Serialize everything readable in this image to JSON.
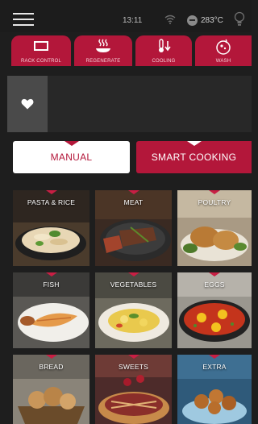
{
  "status_bar": {
    "menu_icon": "hamburger-menu-icon",
    "time": "13:11",
    "wifi_icon": "wifi-icon",
    "temperature": "283°C",
    "temperature_icon": "oven-temperature-icon",
    "light_icon": "light-bulb-icon"
  },
  "actions": [
    {
      "label": "RACK CONTROL",
      "icon": "rack-icon"
    },
    {
      "label": "REGENERATE",
      "icon": "steam-plate-icon"
    },
    {
      "label": "COOLING",
      "icon": "thermometer-down-icon"
    },
    {
      "label": "WASH",
      "icon": "wash-icon"
    }
  ],
  "favorites": {
    "icon": "heart-icon"
  },
  "modes": {
    "manual": "MANUAL",
    "smart": "SMART COOKING"
  },
  "colors": {
    "accent": "#b3173a",
    "background": "#1e1e1e",
    "tile_notch": "#c81f44"
  },
  "categories": [
    {
      "label": "PASTA & RICE"
    },
    {
      "label": "MEAT"
    },
    {
      "label": "POULTRY"
    },
    {
      "label": "FISH"
    },
    {
      "label": "VEGETABLES"
    },
    {
      "label": "EGGS"
    },
    {
      "label": "BREAD"
    },
    {
      "label": "SWEETS"
    },
    {
      "label": "EXTRA"
    }
  ]
}
